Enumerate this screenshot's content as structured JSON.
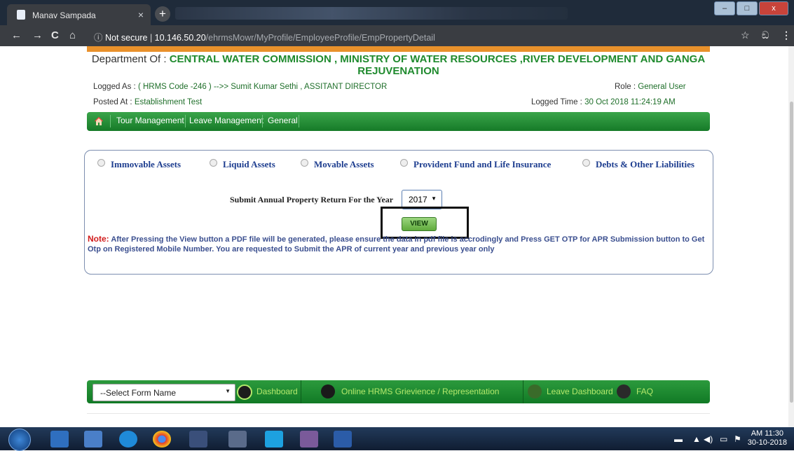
{
  "browser": {
    "tab_title": "Manav Sampada",
    "tab_close": "×",
    "new_tab": "+",
    "security": "Not secure",
    "url_host": "10.146.50.20",
    "url_path": "/ehrmsMowr/MyProfile/EmployeeProfile/EmpPropertyDetail",
    "win_min": "–",
    "win_max": "□",
    "win_close": "x"
  },
  "header": {
    "dept_prefix": "Department Of : ",
    "dept_name": "CENTRAL WATER COMMISSION , MINISTRY OF WATER RESOURCES ,RIVER DEVELOPMENT AND GANGA REJUVENATION",
    "logged_as_label": "Logged As : ",
    "logged_as_value": "( HRMS Code -246 ) -->> Sumit Kumar Sethi , ASSITANT DIRECTOR",
    "role_label": "Role : ",
    "role_value": "General User",
    "posted_label": "Posted At : ",
    "posted_value": "Establishment Test",
    "logged_time_label": "Logged Time : ",
    "logged_time_value": "30 Oct 2018 11:24:19 AM"
  },
  "menu": {
    "items": [
      "Tour Management",
      "Leave Management",
      "General"
    ]
  },
  "assets": {
    "options": [
      "Immovable Assets",
      "Liquid Assets",
      "Movable Assets",
      "Provident Fund and Life Insurance",
      "Debts & Other Liabilities"
    ],
    "year_label": "Submit Annual Property Return For the Year",
    "year_value": "2017",
    "view_label": "VIEW",
    "note_label": "Note:",
    "note_text": " After Pressing the View button a PDF file will be generated, please ensure the data in pdf file is accrodingly and Press GET OTP for APR Submission button to Get Otp on Registered Mobile Number. You are requested to Submit the APR of current year and previous year only"
  },
  "footer": {
    "select_placeholder": "--Select Form Name",
    "links": [
      "Dashboard",
      "Online HRMS Grievience / Representation",
      "Leave Dashboard",
      "FAQ"
    ]
  },
  "taskbar": {
    "time": "AM 11:30",
    "date": "30-10-2018"
  },
  "colors": {
    "menu_green": "#167a28",
    "header_green": "#1f8a2e",
    "note_red": "#d11b1b",
    "accent_orange": "#e9912b"
  }
}
